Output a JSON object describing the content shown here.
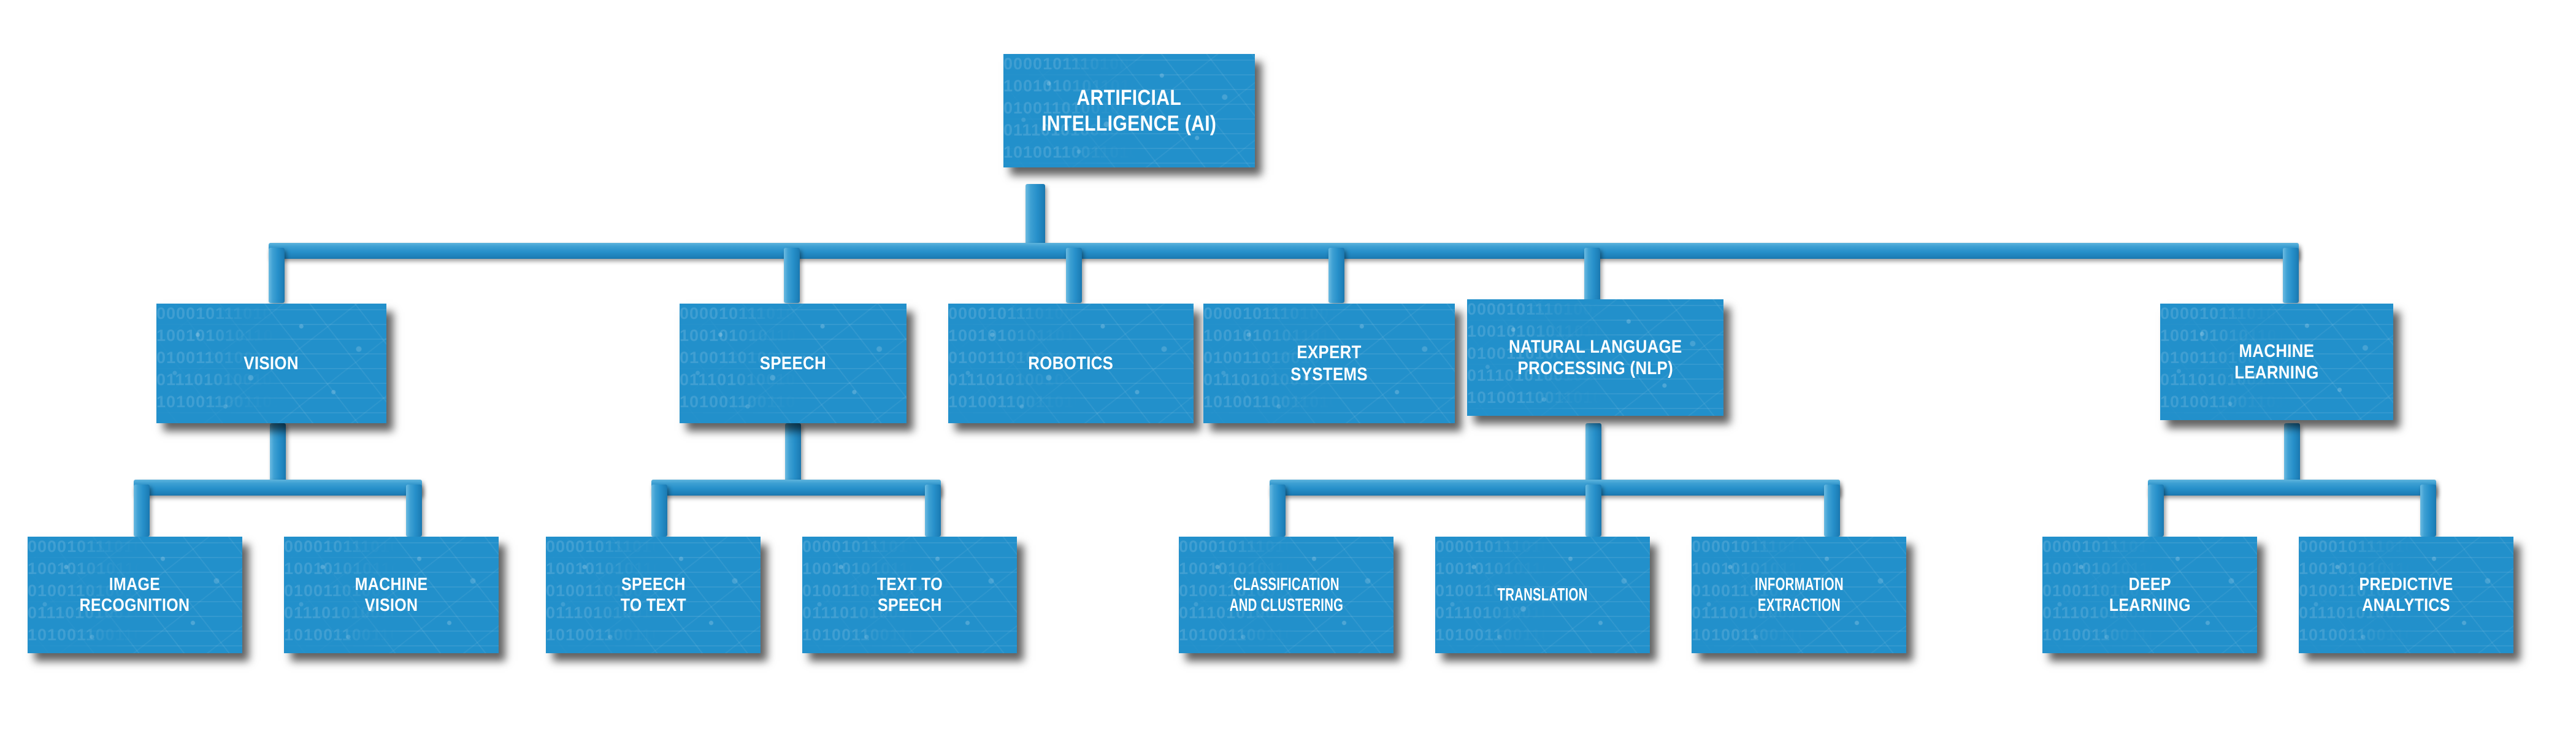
{
  "diagram": {
    "title": "Artificial Intelligence (AI) taxonomy tree",
    "type": "hierarchy-tree",
    "levels": 3,
    "colors": {
      "node_fill": "#2290cb",
      "node_fill_light": "#3ea0d3",
      "connector": "#2790ca",
      "connector_highlight": "#6cbbe1",
      "node_text": "#ffffff",
      "background": "#ffffff",
      "shadow": "#000000"
    },
    "texture": {
      "name": "circuit-binary-texture",
      "binary_rows": [
        "00001011101001010111",
        "10010101011010011100",
        "01001101001011010000",
        "01110101001010011010",
        "10100110011010010100"
      ]
    }
  },
  "nodes": {
    "root": {
      "id": "ai",
      "lines": [
        "ARTIFICIAL",
        "INTELLIGENCE (AI)"
      ],
      "level": 1
    },
    "level2": [
      {
        "id": "vision",
        "lines": [
          "VISION"
        ],
        "level": 2
      },
      {
        "id": "speech",
        "lines": [
          "SPEECH"
        ],
        "level": 2
      },
      {
        "id": "robotics",
        "lines": [
          "ROBOTICS"
        ],
        "level": 2
      },
      {
        "id": "expert-systems",
        "lines": [
          "EXPERT",
          "SYSTEMS"
        ],
        "level": 2
      },
      {
        "id": "nlp",
        "lines": [
          "NATURAL LANGUAGE",
          "PROCESSING (NLP)"
        ],
        "level": 2
      },
      {
        "id": "machine-learning",
        "lines": [
          "MACHINE",
          "LEARNING"
        ],
        "level": 2
      }
    ],
    "level3": [
      {
        "id": "image-recognition",
        "parent": "vision",
        "lines": [
          "IMAGE",
          "RECOGNITION"
        ],
        "level": 3
      },
      {
        "id": "machine-vision",
        "parent": "vision",
        "lines": [
          "MACHINE",
          "VISION"
        ],
        "level": 3
      },
      {
        "id": "speech-to-text",
        "parent": "speech",
        "lines": [
          "SPEECH",
          "TO TEXT"
        ],
        "level": 3
      },
      {
        "id": "text-to-speech",
        "parent": "speech",
        "lines": [
          "TEXT TO",
          "SPEECH"
        ],
        "level": 3
      },
      {
        "id": "classification-and-clustering",
        "parent": "nlp",
        "lines": [
          "CLASSIFICATION",
          "AND CLUSTERING"
        ],
        "level": 3
      },
      {
        "id": "translation",
        "parent": "nlp",
        "lines": [
          "TRANSLATION"
        ],
        "level": 3
      },
      {
        "id": "information-extraction",
        "parent": "nlp",
        "lines": [
          "INFORMATION",
          "EXTRACTION"
        ],
        "level": 3
      },
      {
        "id": "deep-learning",
        "parent": "machine-learning",
        "lines": [
          "DEEP",
          "LEARNING"
        ],
        "level": 3
      },
      {
        "id": "predictive-analytics",
        "parent": "machine-learning",
        "lines": [
          "PREDICTIVE",
          "ANALYTICS"
        ],
        "level": 3
      }
    ]
  },
  "edges": [
    {
      "from": "ai",
      "to": "vision"
    },
    {
      "from": "ai",
      "to": "speech"
    },
    {
      "from": "ai",
      "to": "robotics"
    },
    {
      "from": "ai",
      "to": "expert-systems"
    },
    {
      "from": "ai",
      "to": "nlp"
    },
    {
      "from": "ai",
      "to": "machine-learning"
    },
    {
      "from": "vision",
      "to": "image-recognition"
    },
    {
      "from": "vision",
      "to": "machine-vision"
    },
    {
      "from": "speech",
      "to": "speech-to-text"
    },
    {
      "from": "speech",
      "to": "text-to-speech"
    },
    {
      "from": "nlp",
      "to": "classification-and-clustering"
    },
    {
      "from": "nlp",
      "to": "translation"
    },
    {
      "from": "nlp",
      "to": "information-extraction"
    },
    {
      "from": "machine-learning",
      "to": "deep-learning"
    },
    {
      "from": "machine-learning",
      "to": "predictive-analytics"
    }
  ]
}
